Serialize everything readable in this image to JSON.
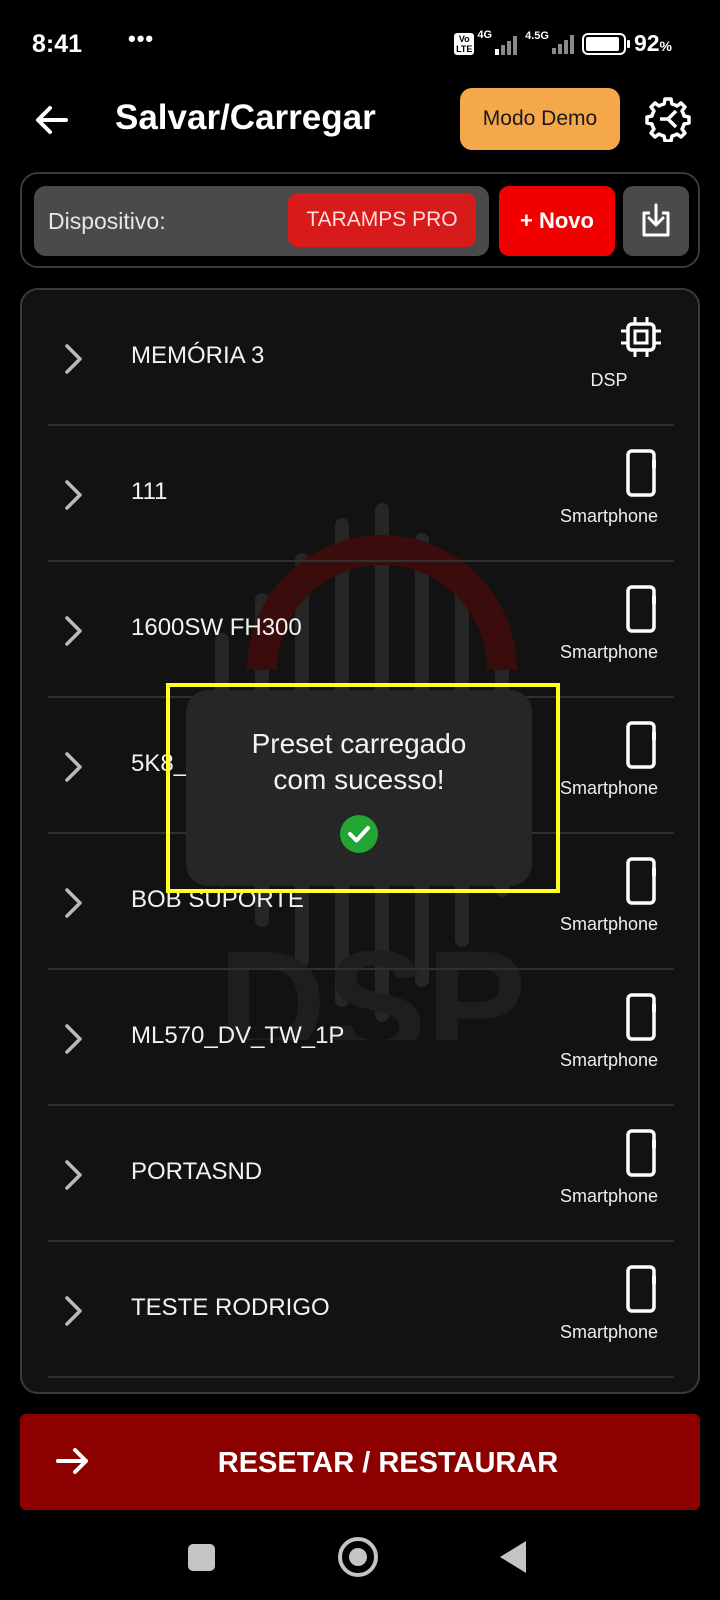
{
  "status_bar": {
    "time": "8:41",
    "dots": "•••",
    "volte": "Vo\nLTE",
    "net1": "4G",
    "net2": "4.5G",
    "battery_pct": "92",
    "battery_unit": "%"
  },
  "header": {
    "title": "Salvar/Carregar",
    "demo_label": "Modo Demo"
  },
  "device": {
    "label": "Dispositivo:",
    "value": "TARAMPS PRO",
    "new_label": "+ Novo"
  },
  "presets": [
    {
      "name": "MEMÓRIA 3",
      "source": "DSP",
      "icon": "chip-icon"
    },
    {
      "name": "111",
      "source": "Smartphone",
      "icon": "smartphone-icon"
    },
    {
      "name": "1600SW FH300",
      "source": "Smartphone",
      "icon": "smartphone-icon"
    },
    {
      "name": "5K8_M",
      "source": "Smartphone",
      "icon": "smartphone-icon"
    },
    {
      "name": "BOB SUPORTE",
      "source": "Smartphone",
      "icon": "smartphone-icon"
    },
    {
      "name": "ML570_DV_TW_1P",
      "source": "Smartphone",
      "icon": "smartphone-icon"
    },
    {
      "name": "PORTASND",
      "source": "Smartphone",
      "icon": "smartphone-icon"
    },
    {
      "name": "TESTE RODRIGO",
      "source": "Smartphone",
      "icon": "smartphone-icon"
    }
  ],
  "watermark_text": "DSP",
  "toast": {
    "line1": "Preset carregado",
    "line2": "com sucesso!"
  },
  "reset_label": "RESETAR / RESTAURAR",
  "colors": {
    "accent_red": "#f20000",
    "chip_red": "#d71a1a",
    "demo_orange": "#f5a84a",
    "reset_dark_red": "#8c0000",
    "success_green": "#22a535",
    "highlight_yellow": "#ffff22"
  }
}
